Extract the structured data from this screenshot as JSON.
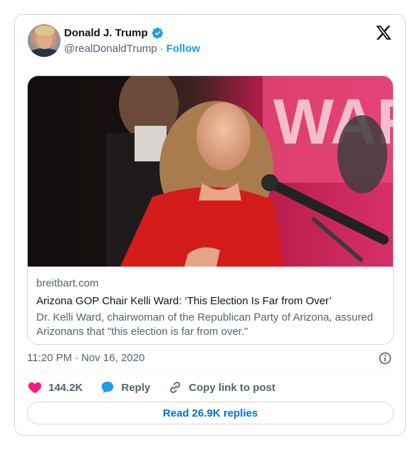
{
  "author": {
    "display_name": "Donald J. Trump",
    "handle": "@realDonaldTrump",
    "separator": "·",
    "follow_label": "Follow",
    "avatar_icon": "avatar-photo",
    "verified_icon": "verified-badge-icon"
  },
  "link_card": {
    "domain": "breitbart.com",
    "headline": "Arizona GOP Chair Kelli Ward: ‘This Election Is Far from Over’",
    "description": "Dr. Kelli Ward, chairwoman of the Republican Party of Arizona, assured Arizonans that \"this election is far from over.\""
  },
  "timestamp": {
    "time": "11:20 PM",
    "separator": "·",
    "date": "Nov 16, 2020"
  },
  "actions": {
    "like_count": "144.2K",
    "reply_label": "Reply",
    "copy_label": "Copy link to post"
  },
  "replies_button": "Read 26.9K replies",
  "colors": {
    "accent": "#1d9bf0",
    "like": "#f91880",
    "link": "#006fd6",
    "secondary_text": "#536471"
  }
}
